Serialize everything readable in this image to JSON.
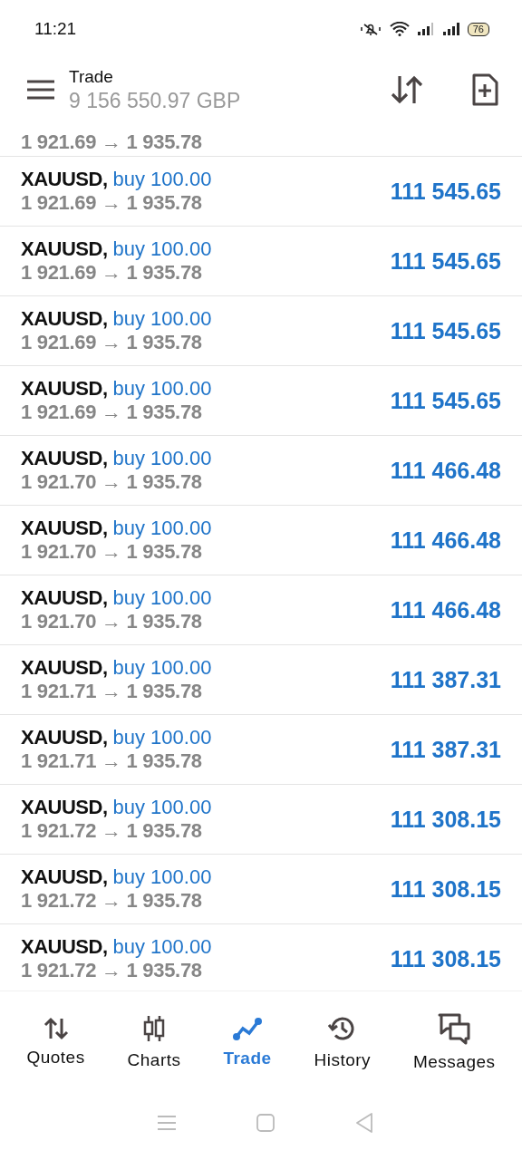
{
  "status_bar": {
    "time": "11:21",
    "battery": "76"
  },
  "header": {
    "title": "Trade",
    "balance": "9 156 550.97 GBP"
  },
  "partial_top_row": {
    "prices": "1 921.69 → 1 935.78"
  },
  "positions": [
    {
      "symbol": "XAUUSD,",
      "side": "buy 100.00",
      "prices": "1 921.69 → 1 935.78",
      "profit": "111 545.65"
    },
    {
      "symbol": "XAUUSD,",
      "side": "buy 100.00",
      "prices": "1 921.69 → 1 935.78",
      "profit": "111 545.65"
    },
    {
      "symbol": "XAUUSD,",
      "side": "buy 100.00",
      "prices": "1 921.69 → 1 935.78",
      "profit": "111 545.65"
    },
    {
      "symbol": "XAUUSD,",
      "side": "buy 100.00",
      "prices": "1 921.69 → 1 935.78",
      "profit": "111 545.65"
    },
    {
      "symbol": "XAUUSD,",
      "side": "buy 100.00",
      "prices": "1 921.70 → 1 935.78",
      "profit": "111 466.48"
    },
    {
      "symbol": "XAUUSD,",
      "side": "buy 100.00",
      "prices": "1 921.70 → 1 935.78",
      "profit": "111 466.48"
    },
    {
      "symbol": "XAUUSD,",
      "side": "buy 100.00",
      "prices": "1 921.70 → 1 935.78",
      "profit": "111 466.48"
    },
    {
      "symbol": "XAUUSD,",
      "side": "buy 100.00",
      "prices": "1 921.71 → 1 935.78",
      "profit": "111 387.31"
    },
    {
      "symbol": "XAUUSD,",
      "side": "buy 100.00",
      "prices": "1 921.71 → 1 935.78",
      "profit": "111 387.31"
    },
    {
      "symbol": "XAUUSD,",
      "side": "buy 100.00",
      "prices": "1 921.72 → 1 935.78",
      "profit": "111 308.15"
    },
    {
      "symbol": "XAUUSD,",
      "side": "buy 100.00",
      "prices": "1 921.72 → 1 935.78",
      "profit": "111 308.15"
    },
    {
      "symbol": "XAUUSD,",
      "side": "buy 100.00",
      "prices": "1 921.72 → 1 935.78",
      "profit": "111 308.15"
    }
  ],
  "bottom_nav": [
    {
      "kind": "quotes",
      "label": "Quotes",
      "selected": false
    },
    {
      "kind": "charts",
      "label": "Charts",
      "selected": false
    },
    {
      "kind": "trade",
      "label": "Trade",
      "selected": true
    },
    {
      "kind": "history",
      "label": "History",
      "selected": false
    },
    {
      "kind": "messages",
      "label": "Messages",
      "selected": false
    }
  ]
}
